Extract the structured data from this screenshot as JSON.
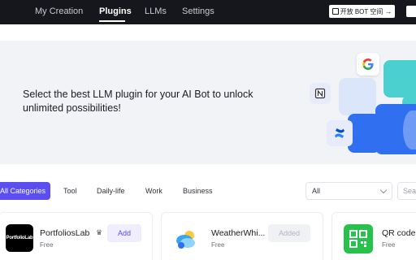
{
  "nav": {
    "items": [
      {
        "label": "My Creation"
      },
      {
        "label": "Plugins"
      },
      {
        "label": "LLMs"
      },
      {
        "label": "Settings"
      }
    ],
    "cta_label": "开放 BOT 空间",
    "cta_arrow": "→"
  },
  "banner": {
    "headline": "Select the best LLM plugin for your AI Bot to unlock unlimited possibilities!",
    "icons": [
      "google-icon",
      "notion-icon",
      "confluence-icon"
    ]
  },
  "categories": {
    "items": [
      "All Categories",
      "Tool",
      "Daily-life",
      "Work",
      "Business"
    ],
    "active": "All Categories"
  },
  "filter": {
    "selected": "All"
  },
  "search": {
    "placeholder": "Sea"
  },
  "cards": [
    {
      "name": "PortfoliosLab",
      "price": "Free",
      "action": "Add",
      "logo_text": "PortfolioLab",
      "verified_icon": "crown-icon"
    },
    {
      "name": "WeatherWhi...",
      "price": "Free",
      "action": "Added"
    },
    {
      "name": "QR code",
      "price": "Free"
    }
  ],
  "colors": {
    "accent": "#5b4ef0",
    "nav_bg": "#16171c",
    "banner_bg": "#f2f3f7"
  }
}
